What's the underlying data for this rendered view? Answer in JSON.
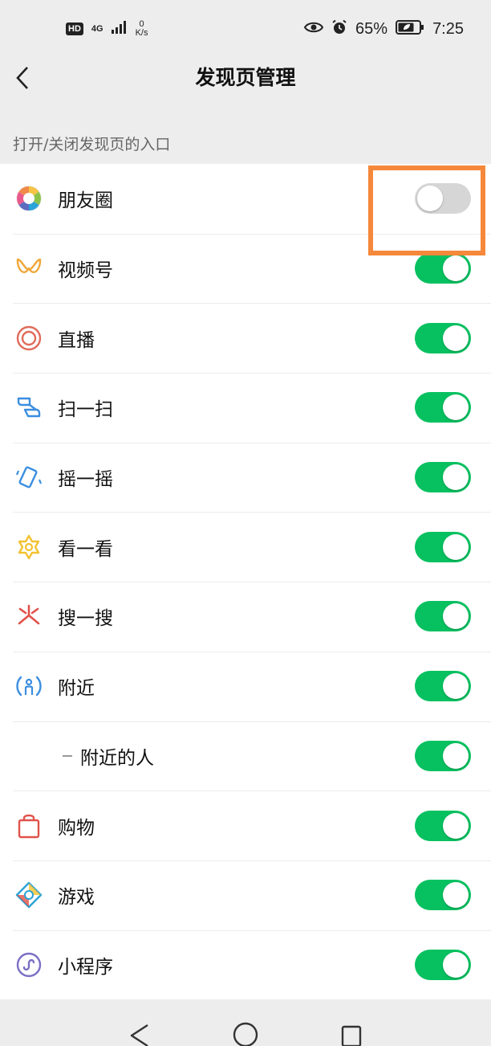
{
  "status_bar": {
    "hd": "HD",
    "network": "4G",
    "speed_value": "0",
    "speed_unit": "K/s",
    "battery": "65%",
    "time": "7:25"
  },
  "header": {
    "title": "发现页管理"
  },
  "section": {
    "caption": "打开/关闭发现页的入口"
  },
  "items": [
    {
      "label": "朋友圈",
      "icon": "moments-icon",
      "enabled": false
    },
    {
      "label": "视频号",
      "icon": "channels-icon",
      "enabled": true
    },
    {
      "label": "直播",
      "icon": "live-icon",
      "enabled": true
    },
    {
      "label": "扫一扫",
      "icon": "scan-icon",
      "enabled": true
    },
    {
      "label": "摇一摇",
      "icon": "shake-icon",
      "enabled": true
    },
    {
      "label": "看一看",
      "icon": "top-stories-icon",
      "enabled": true
    },
    {
      "label": "搜一搜",
      "icon": "search-icon",
      "enabled": true
    },
    {
      "label": "附近",
      "icon": "nearby-icon",
      "enabled": true
    },
    {
      "label": "附近的人",
      "icon": "",
      "enabled": true,
      "sub": true
    },
    {
      "label": "购物",
      "icon": "shopping-icon",
      "enabled": true
    },
    {
      "label": "游戏",
      "icon": "games-icon",
      "enabled": true
    },
    {
      "label": "小程序",
      "icon": "mini-programs-icon",
      "enabled": true
    }
  ],
  "colors": {
    "toggle_on": "#07c160",
    "toggle_off": "#d6d6d6",
    "highlight": "#f5883a",
    "background": "#ededed"
  }
}
